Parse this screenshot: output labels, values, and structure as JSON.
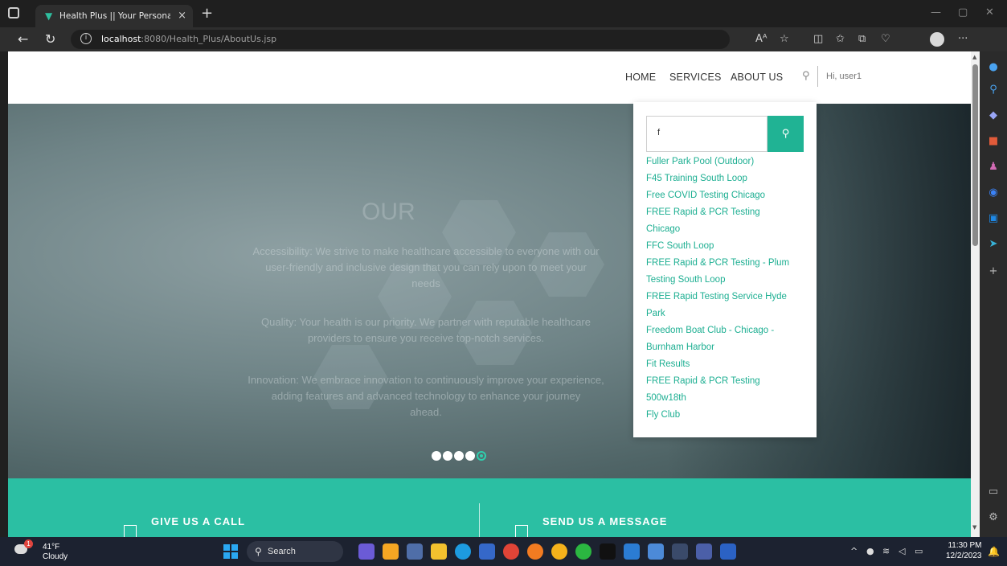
{
  "browser": {
    "tab_title": "Health Plus || Your Personal Heal",
    "tab_close": "×",
    "new_tab": "+",
    "url_host": "localhost",
    "url_path": ":8080/Health_Plus/AboutUs.jsp",
    "reader_icon": "Aᴬ",
    "more": "···"
  },
  "site": {
    "nav": {
      "home": "HOME",
      "services": "SERVICES",
      "about": "ABOUT US"
    },
    "user_greeting": "Hi, user1",
    "hero": {
      "heading": "OUR",
      "line1": "Accessibility: We strive to make healthcare accessible to everyone with our",
      "line2": "user-friendly and inclusive design that you can rely upon to meet your",
      "line3": "needs",
      "line4": "Quality: Your health is our priority. We partner with reputable healthcare",
      "line5": "providers to ensure you receive top-notch services.",
      "line6": "Innovation: We embrace innovation to continuously improve your experience,",
      "line7": "adding features and advanced technology to enhance your journey",
      "line8": "ahead."
    },
    "contact": {
      "call": "GIVE US A CALL",
      "message": "SEND US A MESSAGE"
    },
    "search": {
      "query": "f",
      "results": [
        "Fuller Park Pool (Outdoor)",
        "F45 Training South Loop",
        "Free COVID Testing Chicago",
        "FREE Rapid & PCR Testing",
        "Chicago",
        "FFC South Loop",
        "FREE Rapid & PCR Testing - Plum",
        "Testing South Loop",
        "FREE Rapid Testing Service Hyde",
        "Park",
        "Freedom Boat Club - Chicago -",
        "Burnham Harbor",
        "Fit Results",
        "FREE Rapid & PCR Testing",
        "500w18th",
        "Fly Club"
      ]
    }
  },
  "taskbar": {
    "weather_temp": "41°F",
    "weather_cond": "Cloudy",
    "weather_badge": "1",
    "search_label": "Search",
    "time": "11:30 PM",
    "date": "12/2/2023"
  }
}
